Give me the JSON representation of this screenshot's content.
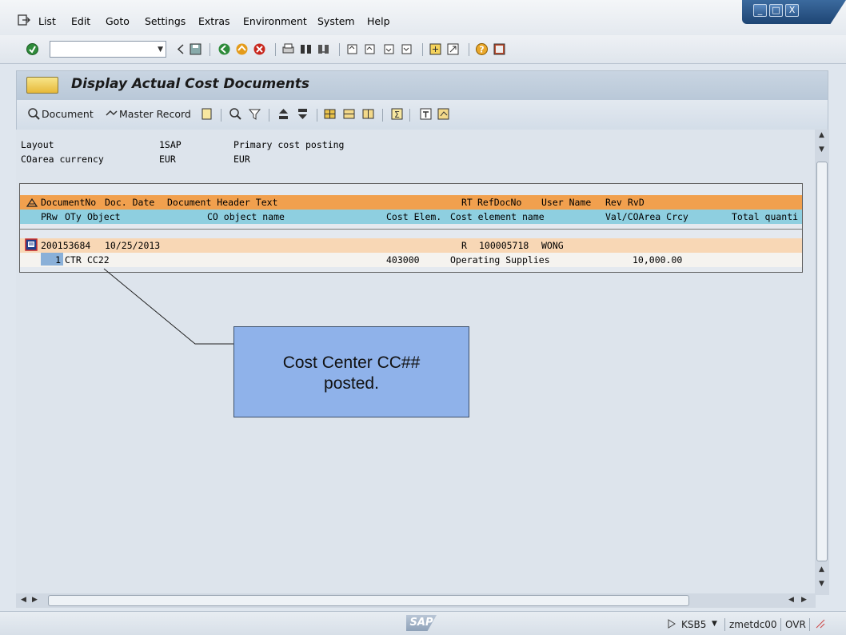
{
  "menu": [
    "List",
    "Edit",
    "Goto",
    "Settings",
    "Extras",
    "Environment",
    "System",
    "Help"
  ],
  "window_buttons": [
    "_",
    "□",
    "X"
  ],
  "command_field": {
    "value": ""
  },
  "title": "Display Actual Cost Documents",
  "app_toolbar": {
    "document": "Document",
    "master_record": "Master Record"
  },
  "header_info": {
    "layout_label": "Layout",
    "layout_value": "1SAP",
    "layout_desc": "Primary cost posting",
    "currency_label": "COarea currency",
    "currency_value": "EUR",
    "currency_value2": "EUR"
  },
  "list": {
    "header1": [
      "DocumentNo",
      "Doc. Date",
      "Document Header Text",
      "RT",
      "RefDocNo",
      "User Name",
      "Rev",
      "RvD"
    ],
    "header2": [
      "PRw",
      "OTy",
      "Object",
      "CO object name",
      "Cost Elem.",
      "Cost element name",
      "Val/COArea Crcy",
      "Total quanti"
    ],
    "document_row": {
      "doc_no": "200153684",
      "doc_date": "10/25/2013",
      "rt": "R",
      "ref_doc_no": "100005718",
      "user": "WONG"
    },
    "item_row": {
      "prw": "1",
      "oty": "CTR",
      "object": "CC22",
      "cost_elem": "403000",
      "cost_elem_name": "Operating Supplies",
      "value": "10,000.00"
    }
  },
  "callout": {
    "text": "Cost Center CC##\nposted."
  },
  "status": {
    "transaction": "KSB5",
    "server": "zmetdc00",
    "mode": "OVR",
    "logo": "SAP"
  }
}
